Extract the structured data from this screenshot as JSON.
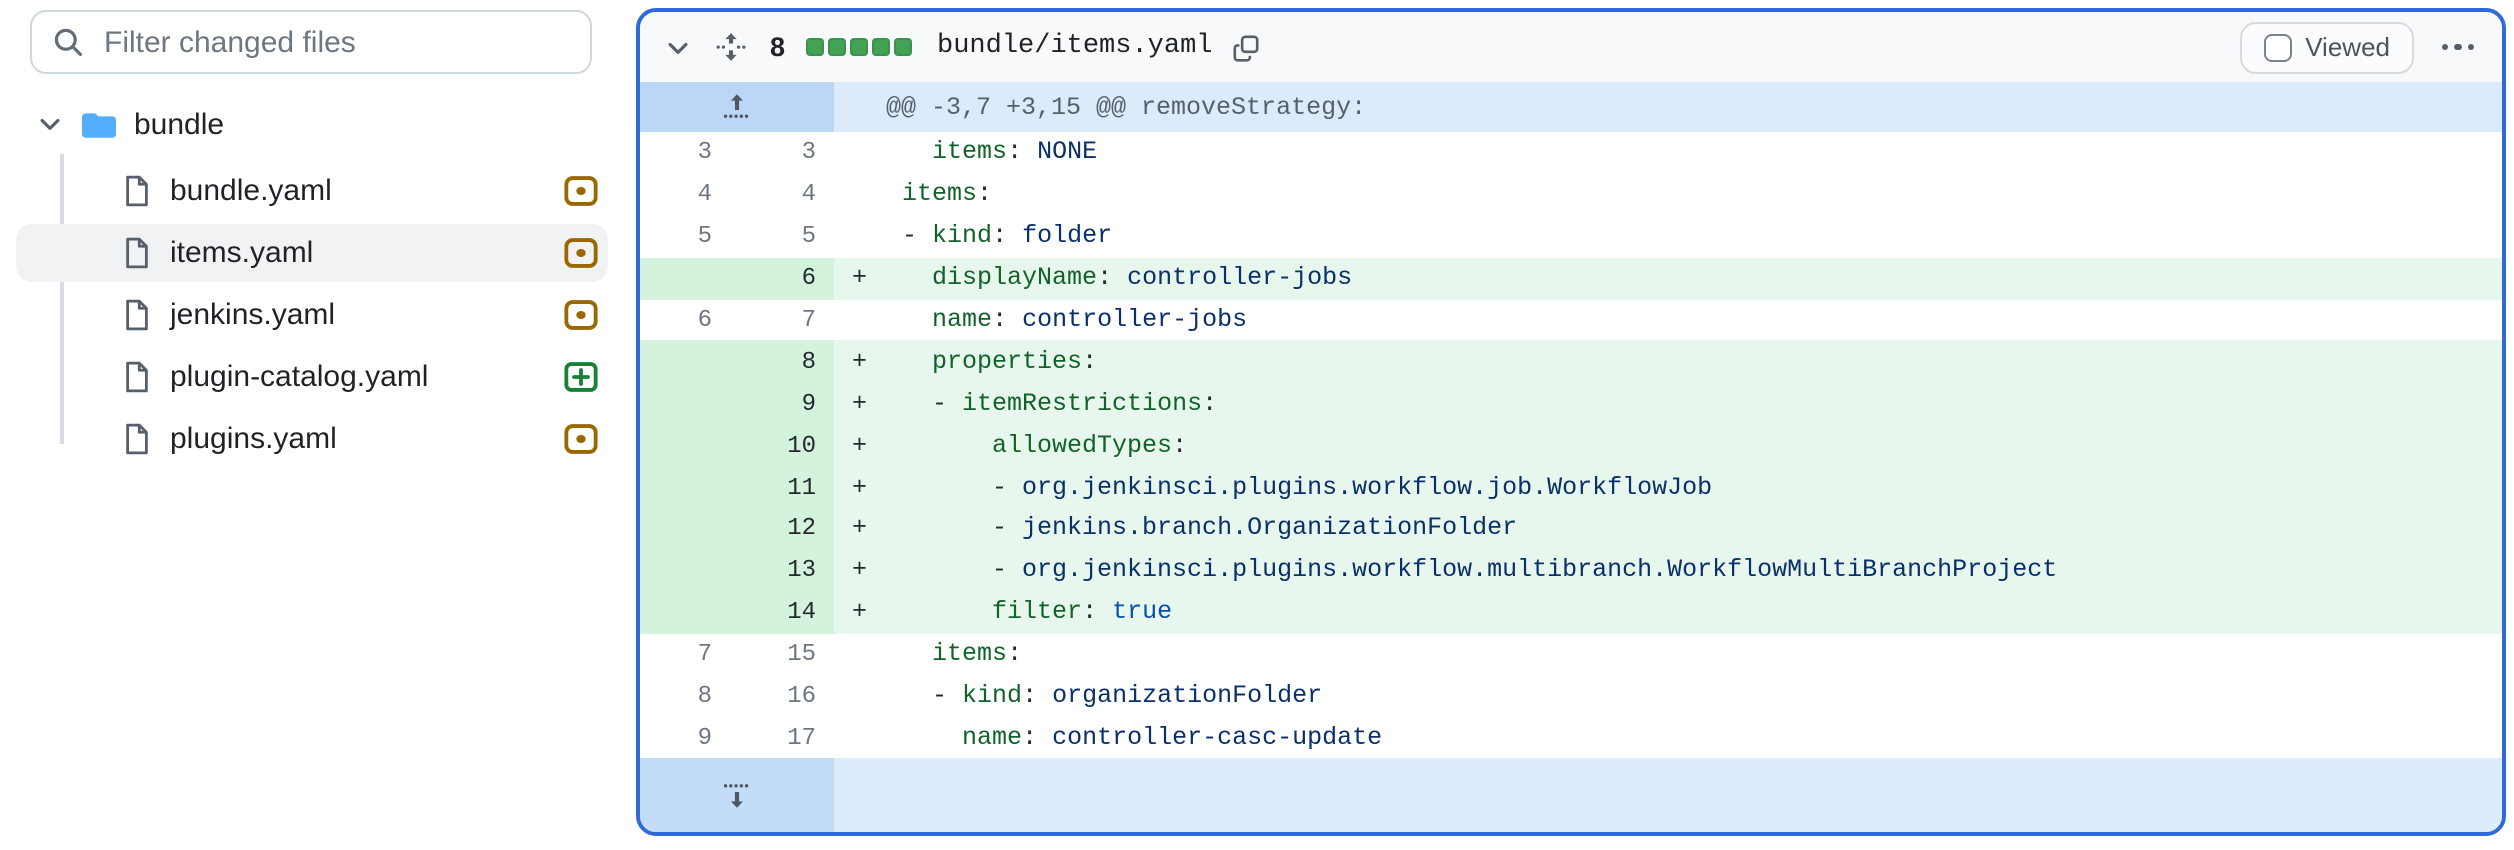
{
  "sidebar": {
    "filter": {
      "placeholder": "Filter changed files"
    },
    "tree": {
      "root_label": "bundle",
      "files": [
        {
          "name": "bundle.yaml",
          "status": "modified",
          "selected": false
        },
        {
          "name": "items.yaml",
          "status": "modified",
          "selected": true
        },
        {
          "name": "jenkins.yaml",
          "status": "modified",
          "selected": false
        },
        {
          "name": "plugin-catalog.yaml",
          "status": "added",
          "selected": false
        },
        {
          "name": "plugins.yaml",
          "status": "modified",
          "selected": false
        }
      ]
    }
  },
  "diff_panel": {
    "header": {
      "changes_count": "8",
      "diffstat": [
        "addition",
        "addition",
        "addition",
        "addition",
        "addition"
      ],
      "file_path": "bundle/items.yaml",
      "viewed_label": "Viewed",
      "viewed_checked": false
    },
    "hunk_header": "@@ -3,7 +3,15 @@ removeStrategy:",
    "lines": [
      {
        "type": "context",
        "old": "3",
        "new": "3",
        "marker": "",
        "segments": [
          [
            "p",
            "  "
          ],
          [
            "k",
            "items"
          ],
          [
            "p",
            ": "
          ],
          [
            "v",
            "NONE"
          ]
        ]
      },
      {
        "type": "context",
        "old": "4",
        "new": "4",
        "marker": "",
        "segments": [
          [
            "k",
            "items"
          ],
          [
            "p",
            ":"
          ]
        ]
      },
      {
        "type": "context",
        "old": "5",
        "new": "5",
        "marker": "",
        "segments": [
          [
            "p",
            "- "
          ],
          [
            "k",
            "kind"
          ],
          [
            "p",
            ": "
          ],
          [
            "v",
            "folder"
          ]
        ]
      },
      {
        "type": "addition",
        "old": "",
        "new": "6",
        "marker": "+",
        "segments": [
          [
            "p",
            "  "
          ],
          [
            "k",
            "displayName"
          ],
          [
            "p",
            ": "
          ],
          [
            "v",
            "controller-jobs"
          ]
        ]
      },
      {
        "type": "context",
        "old": "6",
        "new": "7",
        "marker": "",
        "segments": [
          [
            "p",
            "  "
          ],
          [
            "k",
            "name"
          ],
          [
            "p",
            ": "
          ],
          [
            "v",
            "controller-jobs"
          ]
        ]
      },
      {
        "type": "addition",
        "old": "",
        "new": "8",
        "marker": "+",
        "segments": [
          [
            "p",
            "  "
          ],
          [
            "k",
            "properties"
          ],
          [
            "p",
            ":"
          ]
        ]
      },
      {
        "type": "addition",
        "old": "",
        "new": "9",
        "marker": "+",
        "segments": [
          [
            "p",
            "  - "
          ],
          [
            "k",
            "itemRestrictions"
          ],
          [
            "p",
            ":"
          ]
        ]
      },
      {
        "type": "addition",
        "old": "",
        "new": "10",
        "marker": "+",
        "segments": [
          [
            "p",
            "      "
          ],
          [
            "k",
            "allowedTypes"
          ],
          [
            "p",
            ":"
          ]
        ]
      },
      {
        "type": "addition",
        "old": "",
        "new": "11",
        "marker": "+",
        "segments": [
          [
            "p",
            "      - "
          ],
          [
            "v",
            "org.jenkinsci.plugins.workflow.job.WorkflowJob"
          ]
        ]
      },
      {
        "type": "addition",
        "old": "",
        "new": "12",
        "marker": "+",
        "segments": [
          [
            "p",
            "      - "
          ],
          [
            "v",
            "jenkins.branch.OrganizationFolder"
          ]
        ]
      },
      {
        "type": "addition",
        "old": "",
        "new": "13",
        "marker": "+",
        "segments": [
          [
            "p",
            "      - "
          ],
          [
            "v",
            "org.jenkinsci.plugins.workflow.multibranch.WorkflowMultiBranchProject"
          ]
        ]
      },
      {
        "type": "addition",
        "old": "",
        "new": "14",
        "marker": "+",
        "segments": [
          [
            "p",
            "      "
          ],
          [
            "k",
            "filter"
          ],
          [
            "p",
            ": "
          ],
          [
            "b",
            "true"
          ]
        ]
      },
      {
        "type": "context",
        "old": "7",
        "new": "15",
        "marker": "",
        "segments": [
          [
            "p",
            "  "
          ],
          [
            "k",
            "items"
          ],
          [
            "p",
            ":"
          ]
        ]
      },
      {
        "type": "context",
        "old": "8",
        "new": "16",
        "marker": "",
        "segments": [
          [
            "p",
            "  - "
          ],
          [
            "k",
            "kind"
          ],
          [
            "p",
            ": "
          ],
          [
            "v",
            "organizationFolder"
          ]
        ]
      },
      {
        "type": "context",
        "old": "9",
        "new": "17",
        "marker": "",
        "segments": [
          [
            "p",
            "    "
          ],
          [
            "k",
            "name"
          ],
          [
            "p",
            ": "
          ],
          [
            "v",
            "controller-casc-update"
          ]
        ]
      }
    ]
  },
  "icons": {
    "search": "magnifier-icon",
    "tree_collapse": "chevron-down-icon",
    "folder": "folder-fill-icon",
    "file": "file-outline-icon",
    "status_modified": "diff-modified-icon",
    "status_added": "diff-added-icon",
    "collapse_file": "chevron-down-icon",
    "expand_all": "unfold-vertical-icon",
    "copy_path": "copy-icon",
    "overflow_menu": "kebab-horizontal-icon",
    "expand_hunk_up": "expand-up-icon",
    "expand_hunk_down": "expand-down-icon"
  },
  "colors": {
    "panel_focus_border": "#2f6bd8",
    "addition_line_bg": "#e8f7ed",
    "addition_num_bg": "#d4f3dc",
    "hunk_gutter_bg": "#bcd7f5",
    "hunk_line_bg": "#dcebfb",
    "diffstat_square_green": "#42a256",
    "modified_icon": "#9a6700",
    "added_icon": "#1a7f37",
    "yaml_key": "#116329",
    "yaml_value": "#0a3069",
    "yaml_boolean": "#0550ae",
    "selected_row_bg": "#f0f2f4"
  }
}
